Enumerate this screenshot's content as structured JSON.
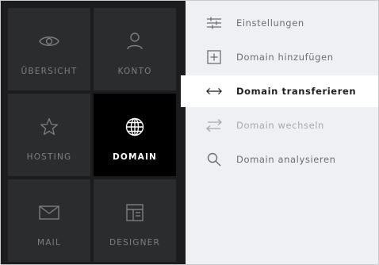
{
  "tiles": [
    {
      "label": "ÜBERSICHT",
      "icon": "eye-icon"
    },
    {
      "label": "KONTO",
      "icon": "user-icon"
    },
    {
      "label": "HOSTING",
      "icon": "star-icon"
    },
    {
      "label": "DOMAIN",
      "icon": "globe-icon",
      "active": true
    },
    {
      "label": "MAIL",
      "icon": "mail-icon"
    },
    {
      "label": "DESIGNER",
      "icon": "layout-icon"
    }
  ],
  "menu": [
    {
      "label": "Einstellungen",
      "icon": "sliders-icon"
    },
    {
      "label": "Domain hinzufügen",
      "icon": "plus-box-icon"
    },
    {
      "label": "Domain transferieren",
      "icon": "arrows-horizontal-icon",
      "active": true
    },
    {
      "label": "Domain wechseln",
      "icon": "swap-icon",
      "disabled": true
    },
    {
      "label": "Domain analysieren",
      "icon": "search-icon"
    }
  ],
  "colors": {
    "grid_bg": "#1c1c1e",
    "tile_bg": "#2b2c2e",
    "tile_active_bg": "#000000",
    "menu_bg": "#eef0f3",
    "menu_active_bg": "#ffffff"
  }
}
